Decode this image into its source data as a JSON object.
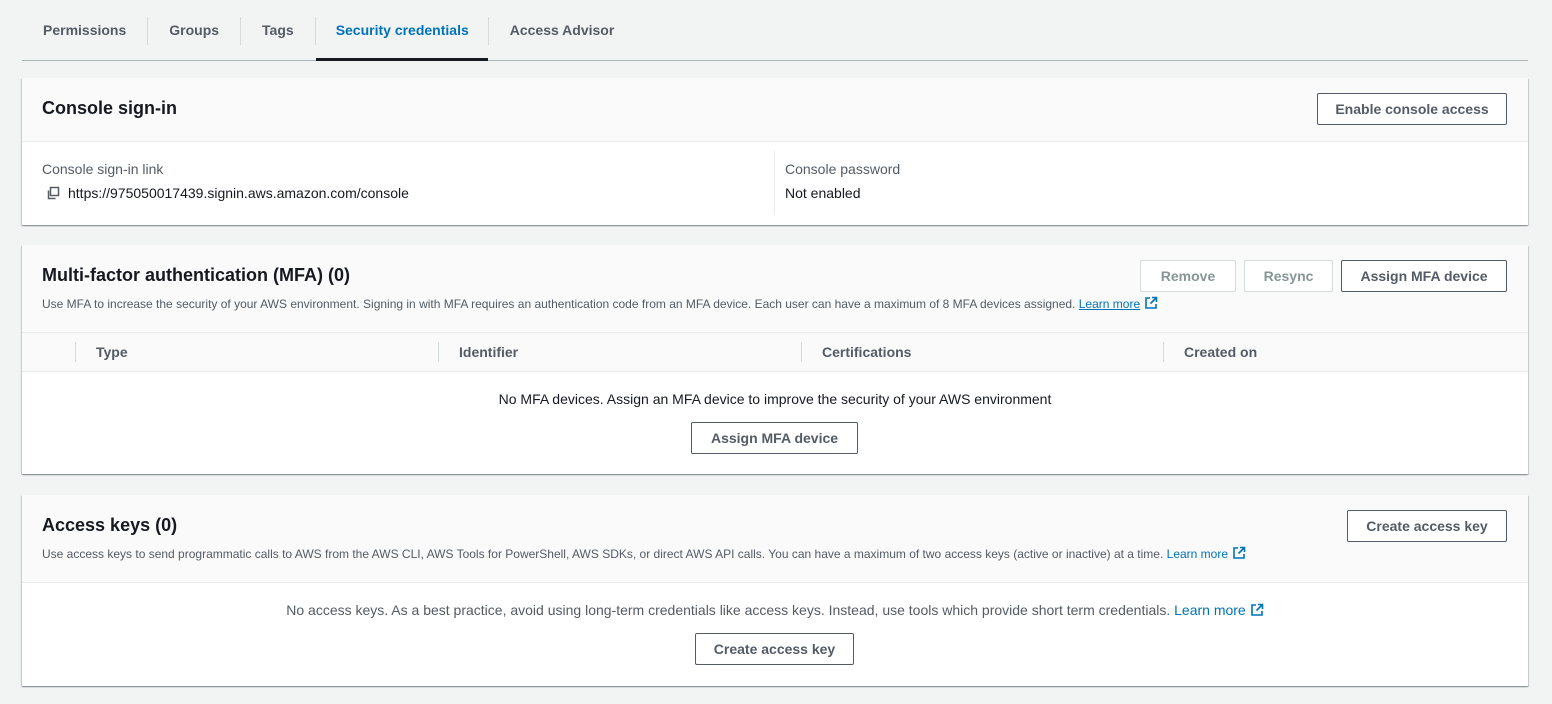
{
  "tabs": [
    {
      "label": "Permissions",
      "active": false
    },
    {
      "label": "Groups",
      "active": false
    },
    {
      "label": "Tags",
      "active": false
    },
    {
      "label": "Security credentials",
      "active": true
    },
    {
      "label": "Access Advisor",
      "active": false
    }
  ],
  "console": {
    "title": "Console sign-in",
    "enable_button": "Enable console access",
    "link_label": "Console sign-in link",
    "link_value": "https://975050017439.signin.aws.amazon.com/console",
    "password_label": "Console password",
    "password_value": "Not enabled"
  },
  "mfa": {
    "title": "Multi-factor authentication (MFA) (0)",
    "description": "Use MFA to increase the security of your AWS environment. Signing in with MFA requires an authentication code from an MFA device. Each user can have a maximum of 8 MFA devices assigned.",
    "learn_more": "Learn more",
    "remove_button": "Remove",
    "resync_button": "Resync",
    "assign_button": "Assign MFA device",
    "columns": [
      "Type",
      "Identifier",
      "Certifications",
      "Created on"
    ],
    "empty_text": "No MFA devices. Assign an MFA device to improve the security of your AWS environment",
    "empty_button": "Assign MFA device"
  },
  "access_keys": {
    "title": "Access keys (0)",
    "description": "Use access keys to send programmatic calls to AWS from the AWS CLI, AWS Tools for PowerShell, AWS SDKs, or direct AWS API calls. You can have a maximum of two access keys (active or inactive) at a time.",
    "learn_more": "Learn more",
    "create_button": "Create access key",
    "empty_text": "No access keys. As a best practice, avoid using long-term credentials like access keys. Instead, use tools which provide short term credentials.",
    "empty_learn_more": "Learn more",
    "empty_button": "Create access key"
  },
  "colors": {
    "link": "#0073bb",
    "background": "#f2f3f3",
    "text": "#16191f",
    "muted": "#545b64"
  }
}
